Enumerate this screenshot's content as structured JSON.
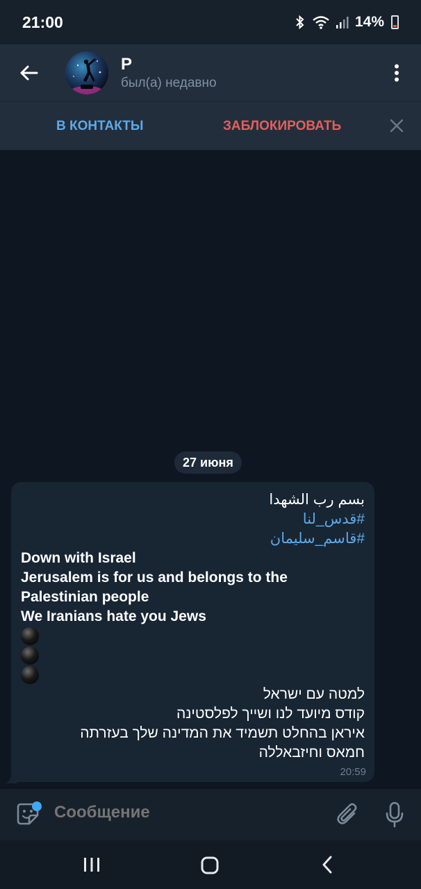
{
  "status_bar": {
    "time": "21:00",
    "battery": "14%",
    "icons": [
      "bluetooth-icon",
      "wifi-icon",
      "signal-icon",
      "battery-icon"
    ]
  },
  "header": {
    "contact_name": "P",
    "contact_status": "был(а) недавно"
  },
  "action_bar": {
    "add_contact": "В КОНТАКТЫ",
    "block": "ЗАБЛОКИРОВАТЬ"
  },
  "chat": {
    "date": "27 июня",
    "message": {
      "arabic_line": "بسم رب الشهدا",
      "hashtag_1": "#قدس_لنا",
      "hashtag_2": "#قاسم_سليمان",
      "english_1": "Down with Israel",
      "english_2": "Jerusalem is for us and belongs to the",
      "english_3": "Palestinian people",
      "english_4": "We Iranians hate you Jews",
      "hebrew_1": "למטה עם ישראל",
      "hebrew_2": "קודס מיועד לנו ושייך לפלסטינה",
      "hebrew_3": "איראן בהחלט תשמיד את המדינה שלך בעזרתה",
      "hebrew_4": "חמאס וחיזבאללה",
      "time": "20:59"
    }
  },
  "input": {
    "placeholder": "Сообщение"
  },
  "colors": {
    "header_bg": "#232e3c",
    "chat_bg": "#0e1621",
    "bubble_bg": "#182533",
    "link": "#5ea9e8",
    "danger": "#e2605c"
  }
}
